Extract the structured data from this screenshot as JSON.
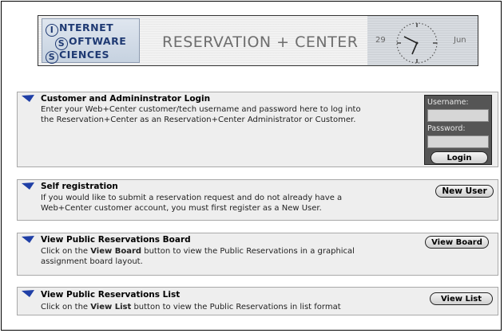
{
  "banner": {
    "logo": {
      "line1": {
        "cap": "I",
        "rest": "NTERNET"
      },
      "line2": {
        "cap": "S",
        "rest": "OFTWARE"
      },
      "line3": {
        "cap": "S",
        "rest": "CIENCES"
      }
    },
    "title": "RESERVATION + CENTER",
    "day": "29",
    "month": "Jun",
    "icon": "clock-icon"
  },
  "login": {
    "title": "Customer and Admininstrator Login",
    "text_line1": "Enter your Web+Center customer/tech username and password here to log into",
    "text_line2": "the Reservation+Center as an Reservation+Center Administrator or Customer.",
    "username_label": "Username:",
    "username_value": "",
    "password_label": "Password:",
    "password_value": "",
    "button": "Login"
  },
  "self_registration": {
    "title": "Self registration",
    "text_line1": "If you would like to submit a reservation request and do not already have a",
    "text_line2": "Web+Center customer account, you must first register as a New User.",
    "button": "New User"
  },
  "board": {
    "title": "View Public Reservations Board",
    "text_pre": "Click on the ",
    "text_bold": "View Board",
    "text_post": " button to view the Public Reservations in a graphical",
    "text_line2": "assignment board layout.",
    "button": "View Board"
  },
  "list": {
    "title": "View Public Reservations List",
    "text_pre": "Click on the ",
    "text_bold": "View List",
    "text_post": " button to view the Public Reservations in list format",
    "button": "View List"
  },
  "colors": {
    "arrow": "#1f3fa6",
    "section_bg": "#eeeeee",
    "login_box_bg": "#555555"
  }
}
